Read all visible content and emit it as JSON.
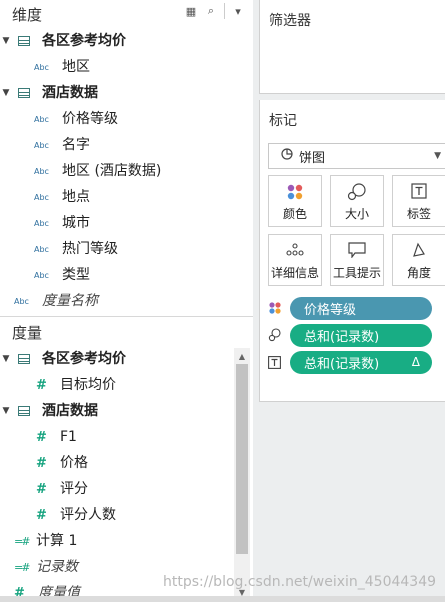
{
  "dimensions": {
    "title": "维度",
    "items": [
      {
        "type": "table",
        "label": "各区参考均价"
      },
      {
        "type": "abc",
        "label": "地区"
      },
      {
        "type": "table",
        "label": "酒店数据"
      },
      {
        "type": "abc",
        "label": "价格等级"
      },
      {
        "type": "abc",
        "label": "名字"
      },
      {
        "type": "abc",
        "label": "地区 (酒店数据)"
      },
      {
        "type": "abc",
        "label": "地点"
      },
      {
        "type": "abc",
        "label": "城市"
      },
      {
        "type": "abc",
        "label": "热门等级"
      },
      {
        "type": "abc",
        "label": "类型"
      },
      {
        "type": "abc",
        "label": "度量名称"
      }
    ],
    "abc_tag": "Abc"
  },
  "measures": {
    "title": "度量",
    "items": [
      {
        "type": "table",
        "label": "各区参考均价"
      },
      {
        "type": "hash",
        "label": "目标均价"
      },
      {
        "type": "table",
        "label": "酒店数据"
      },
      {
        "type": "hash",
        "label": "F1"
      },
      {
        "type": "hash",
        "label": "价格"
      },
      {
        "type": "hash",
        "label": "评分"
      },
      {
        "type": "hash",
        "label": "评分人数"
      },
      {
        "type": "calc",
        "label": "计算 1"
      },
      {
        "type": "calc",
        "label": "记录数"
      },
      {
        "type": "calc",
        "label": "度量值"
      }
    ]
  },
  "filters": {
    "title": "筛选器"
  },
  "marks": {
    "title": "标记",
    "mark_type": "饼图",
    "buttons": [
      "颜色",
      "大小",
      "标签",
      "详细信息",
      "工具提示",
      "角度"
    ],
    "pills": [
      {
        "label": "价格等级",
        "color": "#4a97b0"
      },
      {
        "label": "总和(记录数)",
        "color": "#18ad84"
      },
      {
        "label": "总和(记录数)",
        "color": "#18ad84",
        "badge": "Δ"
      }
    ]
  },
  "watermark": "https://blog.csdn.net/weixin_45044349"
}
